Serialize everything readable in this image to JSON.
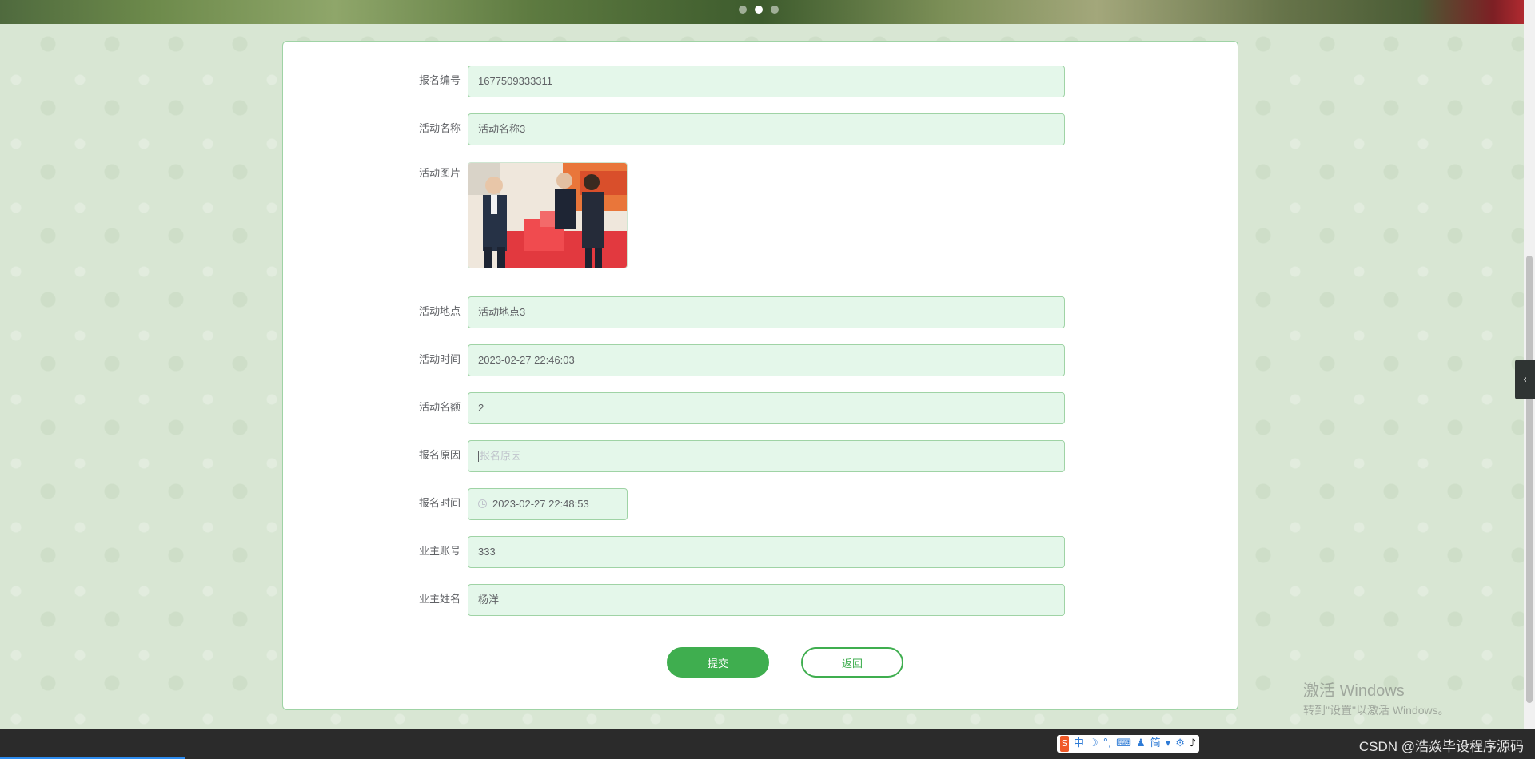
{
  "form": {
    "fields": [
      {
        "label": "报名编号",
        "value": "1677509333311"
      },
      {
        "label": "活动名称",
        "value": "活动名称3"
      },
      {
        "label": "活动图片"
      },
      {
        "label": "活动地点",
        "value": "活动地点3"
      },
      {
        "label": "活动时间",
        "value": "2023-02-27 22:46:03"
      },
      {
        "label": "活动名额",
        "value": "2"
      },
      {
        "label": "报名原因",
        "placeholder": "报名原因"
      },
      {
        "label": "报名时间",
        "value": "2023-02-27 22:48:53"
      },
      {
        "label": "业主账号",
        "value": "333"
      },
      {
        "label": "业主姓名",
        "value": "杨洋"
      }
    ],
    "submit_label": "提交",
    "back_label": "返回"
  },
  "banner": {
    "active_dot": 1,
    "dot_count": 3
  },
  "watermark": {
    "line1": "激活 Windows",
    "line2": "转到\"设置\"以激活 Windows。"
  },
  "taskbar": {
    "ime_items": [
      "中",
      "简"
    ],
    "brand_text": "CSDN @浩焱毕设程序源码"
  },
  "colors": {
    "accent": "#3fae4f",
    "field_bg": "#e4f7ea",
    "field_border": "#9fd3a5",
    "page_bg": "#d8e6d3"
  }
}
